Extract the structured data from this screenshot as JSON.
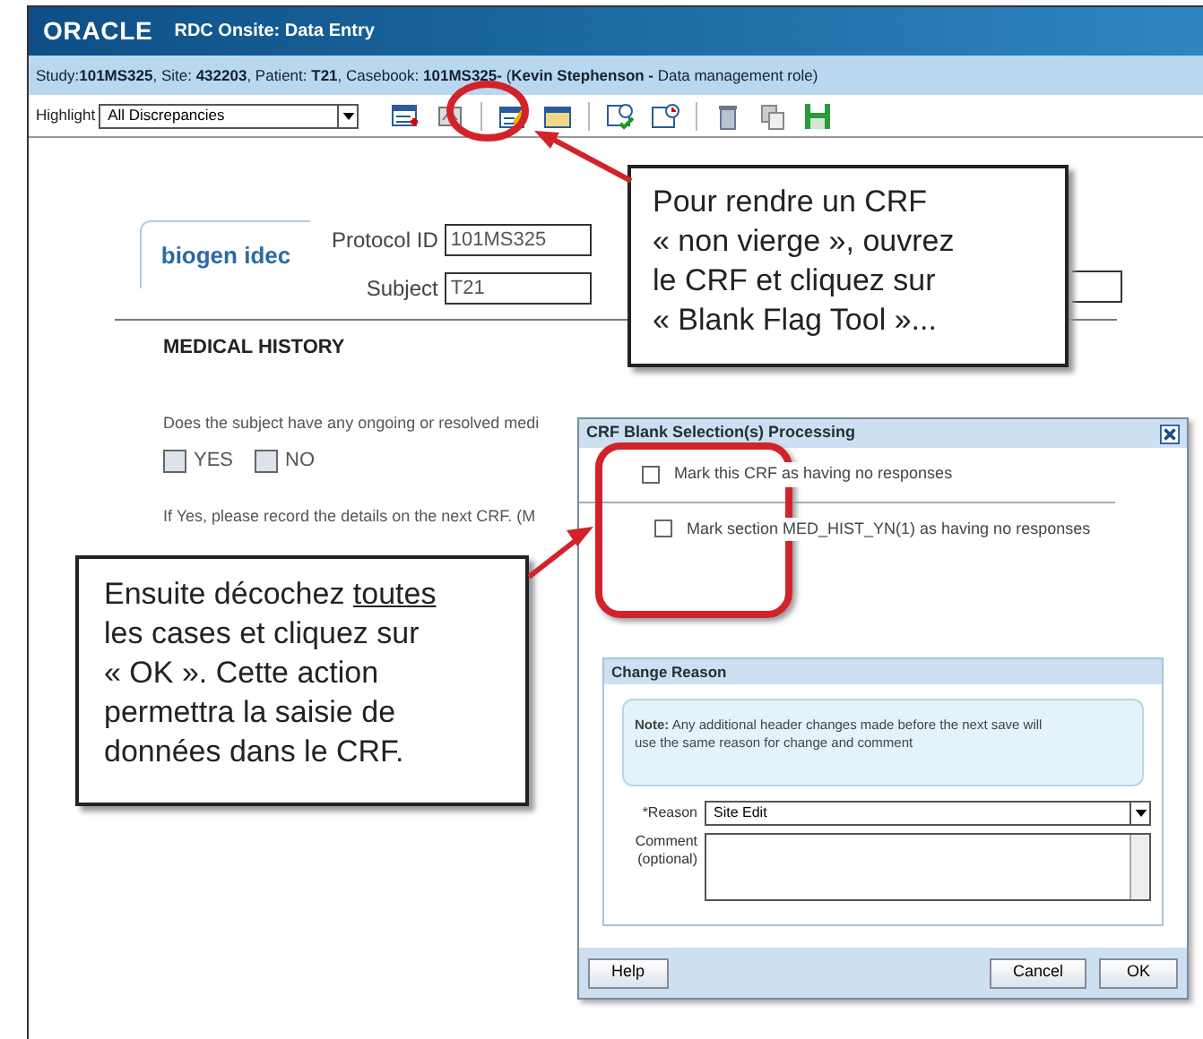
{
  "window": {
    "logo": "ORACLE",
    "title": "RDC Onsite: Data Entry"
  },
  "info_bar": "Study:**101MS325**, Site: **432203**, Patient: **T21**, Casebook: **101MS325-** (**Kevin Stephenson -** Data management role)",
  "toolbar": {
    "highlight_label": "Highlight",
    "highlight_value": "All Discrepancies"
  },
  "form": {
    "sponsor_logo": "biogen idec",
    "fields": [
      {
        "label": "Protocol ID",
        "value": "101MS325"
      },
      {
        "label": "Subject",
        "value": "T21"
      }
    ],
    "section_title": "MEDICAL HISTORY",
    "question": "Does the subject have any ongoing or resolved medi",
    "options": [
      {
        "label": "YES",
        "checked": false
      },
      {
        "label": "NO",
        "checked": false
      }
    ],
    "instruction": "If Yes, please record the details on the next CRF. (M"
  },
  "dialog": {
    "title": "CRF Blank Selection(s) Processing",
    "options": [
      {
        "label": "Mark this CRF as having no responses",
        "checked": false
      },
      {
        "label": "Mark section MED_HIST_YN(1) as having no responses",
        "checked": false
      }
    ],
    "change_reason": {
      "title": "Change Reason",
      "note_label": "Note:",
      "note": "Any additional header changes made before the next save will use the same reason for change and comment",
      "reason_label": "*Reason",
      "reason_value": "Site Edit",
      "comment_label": "Comment (optional)"
    },
    "buttons": [
      {
        "label": "Help"
      },
      {
        "label": "Cancel"
      },
      {
        "label": "OK"
      }
    ]
  },
  "callouts": [
    {
      "lines": [
        {
          "text": "Pour rendre un CRF"
        },
        {
          "text": "« non vierge », ouvrez"
        },
        {
          "text": "le CRF et cliquez sur"
        },
        {
          "text": "« Blank Flag Tool »..."
        }
      ]
    },
    {
      "lines": [
        {
          "text": "Ensuite décochez ",
          "underlined": "toutes"
        },
        {
          "text": "les cases et cliquez sur"
        },
        {
          "text": "« OK ». Cette action"
        },
        {
          "text": "permettra la saisie de"
        },
        {
          "text": "données dans le CRF."
        }
      ]
    }
  ]
}
